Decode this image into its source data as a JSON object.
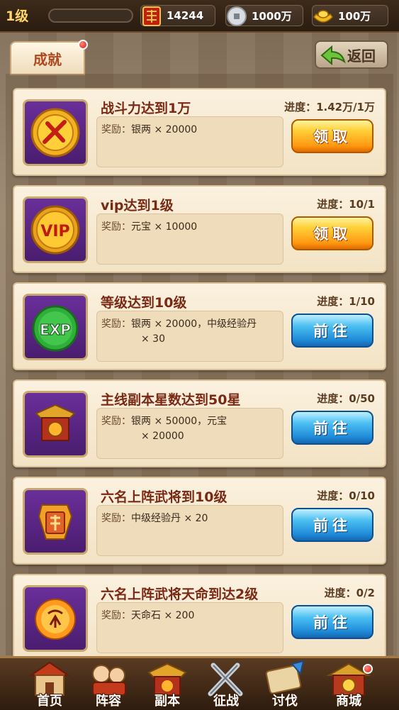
{
  "topbar": {
    "level": "1级",
    "power": "14244",
    "silver": "1000万",
    "gold": "100万"
  },
  "header": {
    "tab_label": "成就",
    "back_label": "返回"
  },
  "achievements": [
    {
      "title": "战斗力达到1万",
      "progress": "进度：1.42万/1万",
      "reward_label": "奖励：",
      "reward_line1": "银两 × 20000",
      "reward_line2": "",
      "button": "领取",
      "icon": "sword-coin-icon"
    },
    {
      "title": "vip达到1级",
      "progress": "进度：10/1",
      "reward_label": "奖励：",
      "reward_line1": "元宝 × 10000",
      "reward_line2": "",
      "button": "领取",
      "icon": "vip-coin-icon"
    },
    {
      "title": "等级达到10级",
      "progress": "进度：1/10",
      "reward_label": "奖励：",
      "reward_line1": "银两 × 20000，中级经验丹",
      "reward_line2": "× 30",
      "button": "前往",
      "icon": "exp-orb-icon"
    },
    {
      "title": "主线副本星数达到50星",
      "progress": "进度：0/50",
      "reward_label": "奖励：",
      "reward_line1": "银两 × 50000，元宝",
      "reward_line2": "× 20000",
      "button": "前往",
      "icon": "dungeon-gate-icon"
    },
    {
      "title": "六名上阵武将到10级",
      "progress": "进度：0/10",
      "reward_label": "奖励：",
      "reward_line1": "中级经验丹 × 20",
      "reward_line2": "",
      "button": "前往",
      "icon": "general-token-icon"
    },
    {
      "title": "六名上阵武将天命到达2级",
      "progress": "进度：0/2",
      "reward_label": "奖励：",
      "reward_line1": "天命石 × 200",
      "reward_line2": "",
      "button": "前往",
      "icon": "destiny-stone-icon"
    }
  ],
  "nav": [
    {
      "label": "首页",
      "icon": "home-icon"
    },
    {
      "label": "阵容",
      "icon": "lineup-icon"
    },
    {
      "label": "副本",
      "icon": "dungeon-icon"
    },
    {
      "label": "征战",
      "icon": "battle-icon"
    },
    {
      "label": "讨伐",
      "icon": "crusade-icon"
    },
    {
      "label": "商城",
      "icon": "shop-icon"
    }
  ],
  "colors": {
    "claim_button": "#ffb41a",
    "go_button": "#2a97e0",
    "title_text": "#7a2a14",
    "badge_red": "#d81515"
  }
}
